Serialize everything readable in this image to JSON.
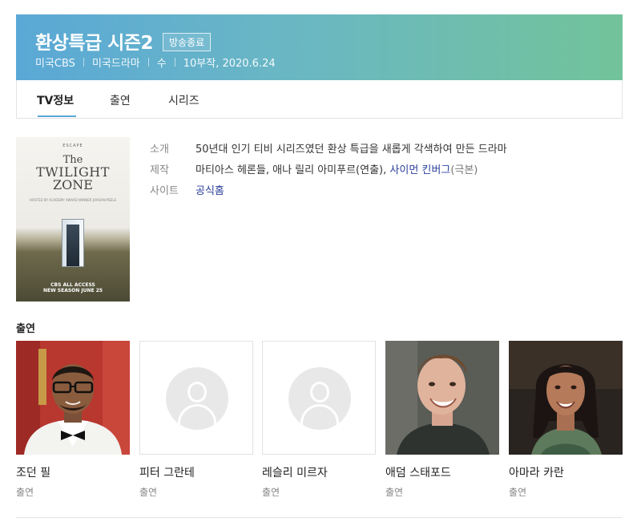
{
  "header": {
    "title": "환상특급 시즌2",
    "badge": "방송종료",
    "meta": [
      "미국CBS",
      "미국드라마",
      "수",
      "10부작, 2020.6.24"
    ],
    "gradient_colors": [
      "#5aa8d6",
      "#72c39a"
    ]
  },
  "tabs": [
    {
      "label": "TV정보",
      "active": true
    },
    {
      "label": "출연",
      "active": false
    },
    {
      "label": "시리즈",
      "active": false
    }
  ],
  "poster": {
    "top_text": "ESCAPE",
    "title_lines": [
      "The",
      "TWILIGHT",
      "ZONE"
    ],
    "small_text": "HOSTED BY ACADEMY AWARD WINNER JORDAN PEELE",
    "network": "CBS ALL ACCESS",
    "season": "NEW SEASON JUNE 25"
  },
  "info": {
    "intro_label": "소개",
    "intro_value": "50년대 인기 티비 시리즈였던 환상 특급을 새롭게 각색하여 만든 드라마",
    "production_label": "제작",
    "production_plain": "마티아스 헤론들, 애나 릴리 아미푸르(연출),",
    "production_link": "사이먼 킨버그",
    "production_suffix": "(극본)",
    "site_label": "사이트",
    "site_value": "공식홈",
    "link_color": "#2b3f9a"
  },
  "cast_section": {
    "title": "출연",
    "members": [
      {
        "name": "조던 필",
        "role": "출연",
        "has_photo": true
      },
      {
        "name": "피터 그란테",
        "role": "출연",
        "has_photo": false
      },
      {
        "name": "레슬리 미르자",
        "role": "출연",
        "has_photo": false
      },
      {
        "name": "애덤 스태포드",
        "role": "출연",
        "has_photo": true
      },
      {
        "name": "아마라 카란",
        "role": "출연",
        "has_photo": true
      }
    ]
  }
}
